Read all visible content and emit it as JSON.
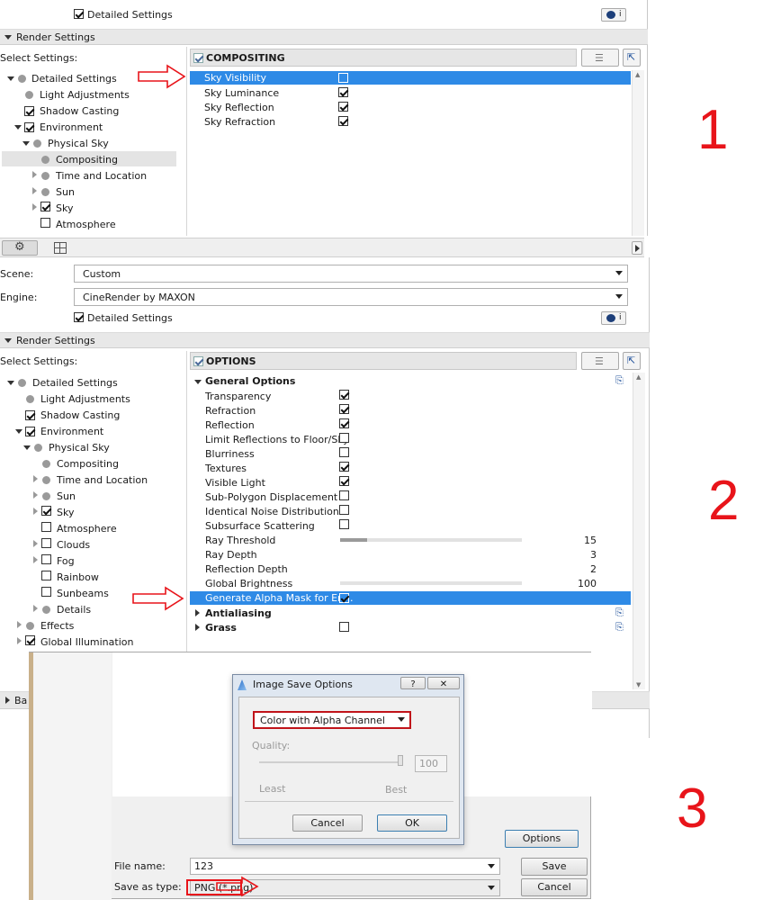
{
  "panel1": {
    "detailed_settings": "Detailed Settings",
    "render_settings": "Render Settings",
    "select_settings": "Select Settings:",
    "section_title": "COMPOSITING",
    "tree": [
      "Detailed Settings",
      "Light Adjustments",
      "Shadow Casting",
      "Environment",
      "Physical Sky",
      "Compositing",
      "Time and Location",
      "Sun",
      "Sky",
      "Atmosphere"
    ],
    "options": [
      {
        "label": "Sky Visibility",
        "checked": false
      },
      {
        "label": "Sky Luminance",
        "checked": true
      },
      {
        "label": "Sky Reflection",
        "checked": true
      },
      {
        "label": "Sky Refraction",
        "checked": true
      }
    ],
    "number": "1"
  },
  "panel2": {
    "scene_label": "Scene:",
    "scene_value": "Custom",
    "engine_label": "Engine:",
    "engine_value": "CineRender by MAXON",
    "detailed_settings": "Detailed Settings",
    "render_settings": "Render Settings",
    "select_settings": "Select Settings:",
    "section_title": "OPTIONS",
    "general_options": "General Options",
    "tree": [
      "Detailed Settings",
      "Light Adjustments",
      "Shadow Casting",
      "Environment",
      "Physical Sky",
      "Compositing",
      "Time and Location",
      "Sun",
      "Sky",
      "Atmosphere",
      "Clouds",
      "Fog",
      "Rainbow",
      "Sunbeams",
      "Details",
      "Effects",
      "Global Illumination"
    ],
    "options": [
      {
        "label": "Transparency",
        "checked": true
      },
      {
        "label": "Refraction",
        "checked": true
      },
      {
        "label": "Reflection",
        "checked": true
      },
      {
        "label": "Limit Reflections to Floor/Sky",
        "checked": false
      },
      {
        "label": "Blurriness",
        "checked": false
      },
      {
        "label": "Textures",
        "checked": true
      },
      {
        "label": "Visible Light",
        "checked": true
      },
      {
        "label": "Sub-Polygon Displacement",
        "checked": false
      },
      {
        "label": "Identical Noise Distribution",
        "checked": false
      },
      {
        "label": "Subsurface Scattering",
        "checked": false
      }
    ],
    "sliders": [
      {
        "label": "Ray Threshold",
        "value": "15",
        "fraction": 0.15
      },
      {
        "label": "Ray Depth",
        "value": "3",
        "fraction": 0
      },
      {
        "label": "Reflection Depth",
        "value": "2",
        "fraction": 0
      },
      {
        "label": "Global Brightness",
        "value": "100",
        "fraction": 0
      }
    ],
    "alpha_mask": "Generate Alpha Mask for En...",
    "antialiasing": "Antialiasing",
    "grass": "Grass",
    "number": "2"
  },
  "panel3": {
    "dialog_title": "Image Save Options",
    "help_glyph": "?",
    "close_glyph": "✕",
    "mode_value": "Color with Alpha Channel",
    "quality_label": "Quality:",
    "quality_value": "100",
    "least": "Least",
    "best": "Best",
    "cancel": "Cancel",
    "ok": "OK",
    "options_btn": "Options",
    "file_name_label": "File name:",
    "file_name_value": "123",
    "save_type_label": "Save as type:",
    "save_type_value": "PNG (*.png)",
    "save_btn": "Save",
    "cancel_btn": "Cancel",
    "partial_label": "Ba",
    "number": "3"
  },
  "colors": {
    "selection": "#2e8ae6",
    "accent_red": "#e8141a"
  }
}
